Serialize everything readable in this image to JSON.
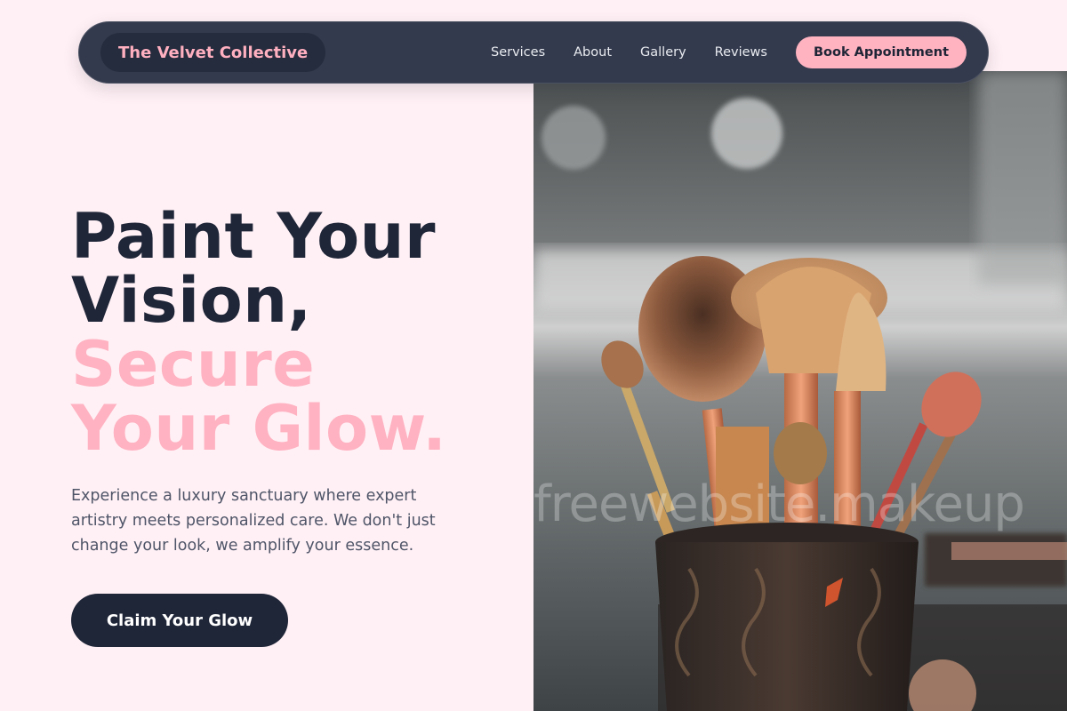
{
  "nav": {
    "brand": "The Velvet Collective",
    "links": [
      "Services",
      "About",
      "Gallery",
      "Reviews"
    ],
    "cta": "Book Appointment"
  },
  "hero": {
    "headline_lines": [
      "Paint Your",
      "Vision,"
    ],
    "highlight_lines": [
      "Secure",
      "Your Glow."
    ],
    "description": "Experience a luxury sanctuary where expert artistry meets personalized care. We don't just change your look, we amplify your essence.",
    "cta": "Claim Your Glow"
  },
  "image": {
    "subject": "makeup brushes in a holder",
    "watermark": "freewebsite.makeup"
  },
  "colors": {
    "background": "#fff0f5",
    "nav": "#333a4d",
    "brand_pill": "#252c3d",
    "accent_pink": "#ffb3c1",
    "dark": "#1f2638"
  }
}
